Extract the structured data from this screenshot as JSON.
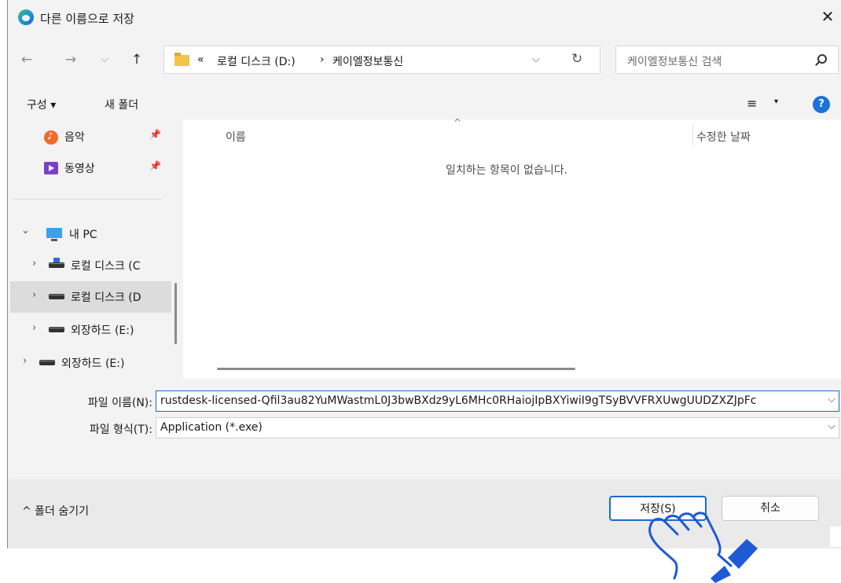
{
  "window": {
    "title": "다른 이름으로 저장",
    "close_glyph": "✕"
  },
  "nav": {
    "back": "←",
    "forward": "→",
    "recent": "⌵",
    "up": "↑",
    "breadcrumb": [
      "«",
      "로컬 디스크 (D:)",
      "›",
      "케이엘정보통신"
    ],
    "dropdown": "⌵",
    "refresh": "↻"
  },
  "search": {
    "placeholder": "케이엘정보통신 검색"
  },
  "toolbar": {
    "organize": "구성 ▾",
    "new_folder": "새 폴더",
    "view": "≡",
    "view_caret": "▾",
    "help": "?"
  },
  "sidebar": {
    "items": [
      {
        "label": "음악",
        "icon": "music-icon",
        "pinned": true
      },
      {
        "label": "동영상",
        "icon": "video-icon",
        "pinned": true
      },
      {
        "label": "내 PC",
        "icon": "pc-icon",
        "expanded": true
      },
      {
        "label": "로컬 디스크 (C",
        "icon": "disk-icon"
      },
      {
        "label": "로컬 디스크 (D",
        "icon": "disk-icon",
        "selected": true
      },
      {
        "label": "외장하드 (E:)",
        "icon": "disk-icon"
      },
      {
        "label": "외장하드 (E:)",
        "icon": "disk-icon"
      }
    ],
    "pin_glyph": "📌",
    "expand_glyph": "›",
    "collapse_glyph": "⌄"
  },
  "content": {
    "columns": [
      "이름",
      "수정한 날짜"
    ],
    "sort_glyph": "^",
    "empty_message": "일치하는 항목이 없습니다."
  },
  "form": {
    "filename_label": "파일 이름(N):",
    "filename_value": "rustdesk-licensed-Qfil3au82YuMWastmL0J3bwBXdz9yL6MHc0RHaiojIpBXYiwiI9gTSyBVVFRXUwgUUDZXZJpFc",
    "filetype_label": "파일 형식(T):",
    "filetype_value": "Application (*.exe)",
    "caret": "⌵"
  },
  "footer": {
    "hide_folders": "^ 폴더 숨기기",
    "save": "저장(S)",
    "cancel": "취소"
  },
  "colors": {
    "accent": "#1a6bd0",
    "cursor_hand": "#1e5ad6"
  }
}
